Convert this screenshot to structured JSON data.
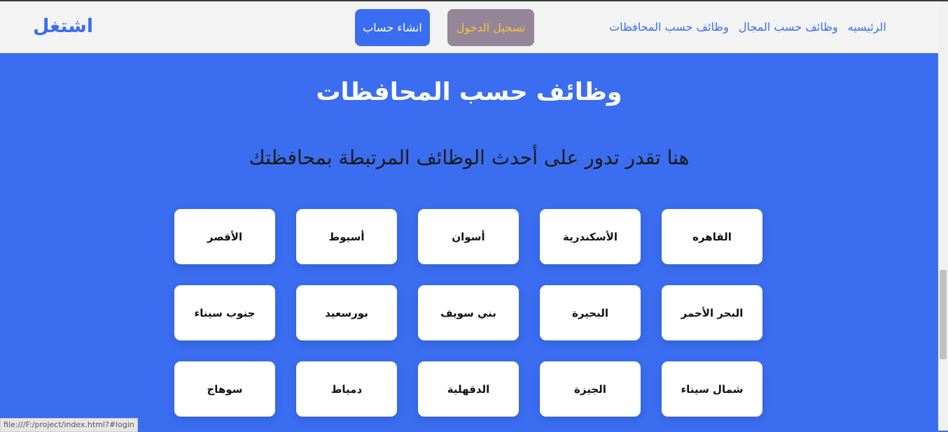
{
  "colors": {
    "accent": "#3a6df0",
    "navbar_bg": "#f3f3f3",
    "login_bg": "#958599",
    "login_text": "#f5c33b"
  },
  "nav": {
    "brand": "اشتغل",
    "links": [
      "الرئيسيه",
      "وظائف حسب المجال",
      "وظائف حسب المحافظات"
    ],
    "login_label": "تسجيل الدخول",
    "register_label": "انشاء حساب"
  },
  "hero": {
    "title": "وظائف حسب المحافظات",
    "subtitle": "هنا تقدر تدور على أحدث الوظائف المرتبطة بمحافظتك"
  },
  "governorates": [
    "القاهره",
    "الأسكندرية",
    "أسوان",
    "أسيوط",
    "الأقصر",
    "البحر الأحمر",
    "البحيرة",
    "بني سويف",
    "بورسعيد",
    "جنوب سيناء",
    "شمال سيناء",
    "الجيزة",
    "الدقهلية",
    "دمياط",
    "سوهاج"
  ],
  "status_bar": {
    "url": "file:///F:/project/index.html?#login"
  }
}
